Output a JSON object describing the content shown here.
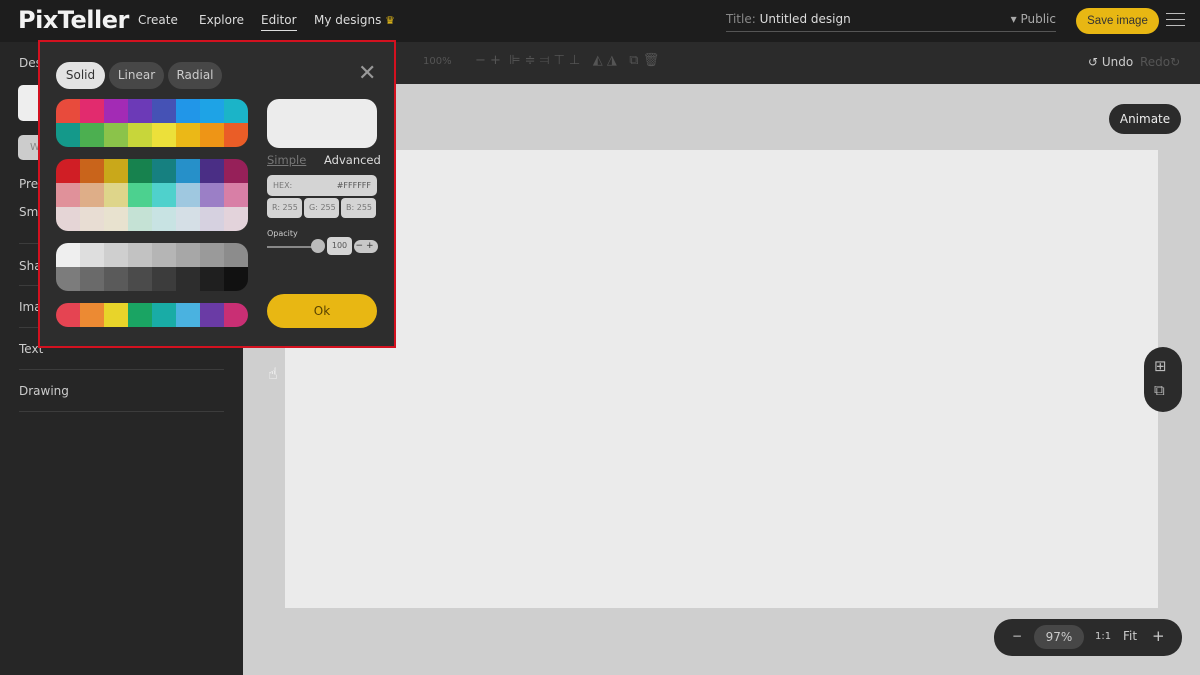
{
  "header": {
    "logo": "PixTeller",
    "nav": [
      "Create",
      "Explore",
      "Editor",
      "My designs"
    ],
    "crown_icon": "♛",
    "title_label": "Title:",
    "title_value": "Untitled design",
    "visibility": "▾ Public",
    "save": "Save image"
  },
  "toolbar": {
    "zoom": "100%",
    "undo": "Undo",
    "redo": "Redo"
  },
  "sidebar": {
    "items": [
      "Des",
      "Pre",
      "Sm",
      "Sha",
      "Ima",
      "Text",
      "Drawing"
    ],
    "button": "W"
  },
  "canvas": {
    "animate": "Animate",
    "zoom_minus": "−",
    "zoom_value": "97%",
    "zoom_one": "1:1",
    "zoom_fit": "Fit",
    "zoom_plus": "+"
  },
  "color_picker": {
    "tabs": [
      "Solid",
      "Linear",
      "Radial"
    ],
    "close": "✕",
    "mode_simple": "Simple",
    "mode_advanced": "Advanced",
    "hex_label": "HEX:",
    "hex_value": "#FFFFFF",
    "r": "R: 255",
    "g": "G: 255",
    "b": "B: 255",
    "opacity_label": "Opacity",
    "opacity_value": "100",
    "opacity_buttons": "−+",
    "ok": "Ok",
    "palettes": [
      [
        [
          "#e84b3c",
          "#e22b6e",
          "#a32bb5",
          "#6c3ab7",
          "#4552b5",
          "#2196e8",
          "#1ea3e6",
          "#1bb4c8"
        ],
        [
          "#14998a",
          "#4caf50",
          "#8bc34a",
          "#c8d63a",
          "#ece03a",
          "#ebb817",
          "#ee9516",
          "#ea5d27"
        ]
      ],
      [
        [
          "#d01e25",
          "#c9641b",
          "#c9a81a",
          "#17824e",
          "#168080",
          "#2690c9",
          "#4a2e85",
          "#962059"
        ],
        [
          "#e0919a",
          "#deae88",
          "#ded58a",
          "#4cd18f",
          "#4fd1cc",
          "#9fc8e0",
          "#9b7fc6",
          "#d87fa6"
        ],
        [
          "#e5d5d6",
          "#e8ddd3",
          "#e8e2cf",
          "#c5e2d5",
          "#c8e3e3",
          "#d5dfe6",
          "#d6d1e0",
          "#e3d3db"
        ]
      ],
      [
        [
          "#efefef",
          "#dedede",
          "#cfcfcf",
          "#c2c2c2",
          "#b5b5b5",
          "#a7a7a7",
          "#9a9a9a",
          "#8c8c8c"
        ],
        [
          "#7c7c7c",
          "#6a6a6a",
          "#5a5a5a",
          "#4b4b4b",
          "#3c3c3c",
          "#2d2d2d",
          "#1f1f1f",
          "#111111"
        ]
      ],
      [
        [
          "#e54452",
          "#ec8a33",
          "#e8d42a",
          "#1aa463",
          "#19aca6",
          "#4ab2e0",
          "#6a3ba5",
          "#c92f74"
        ]
      ]
    ]
  }
}
